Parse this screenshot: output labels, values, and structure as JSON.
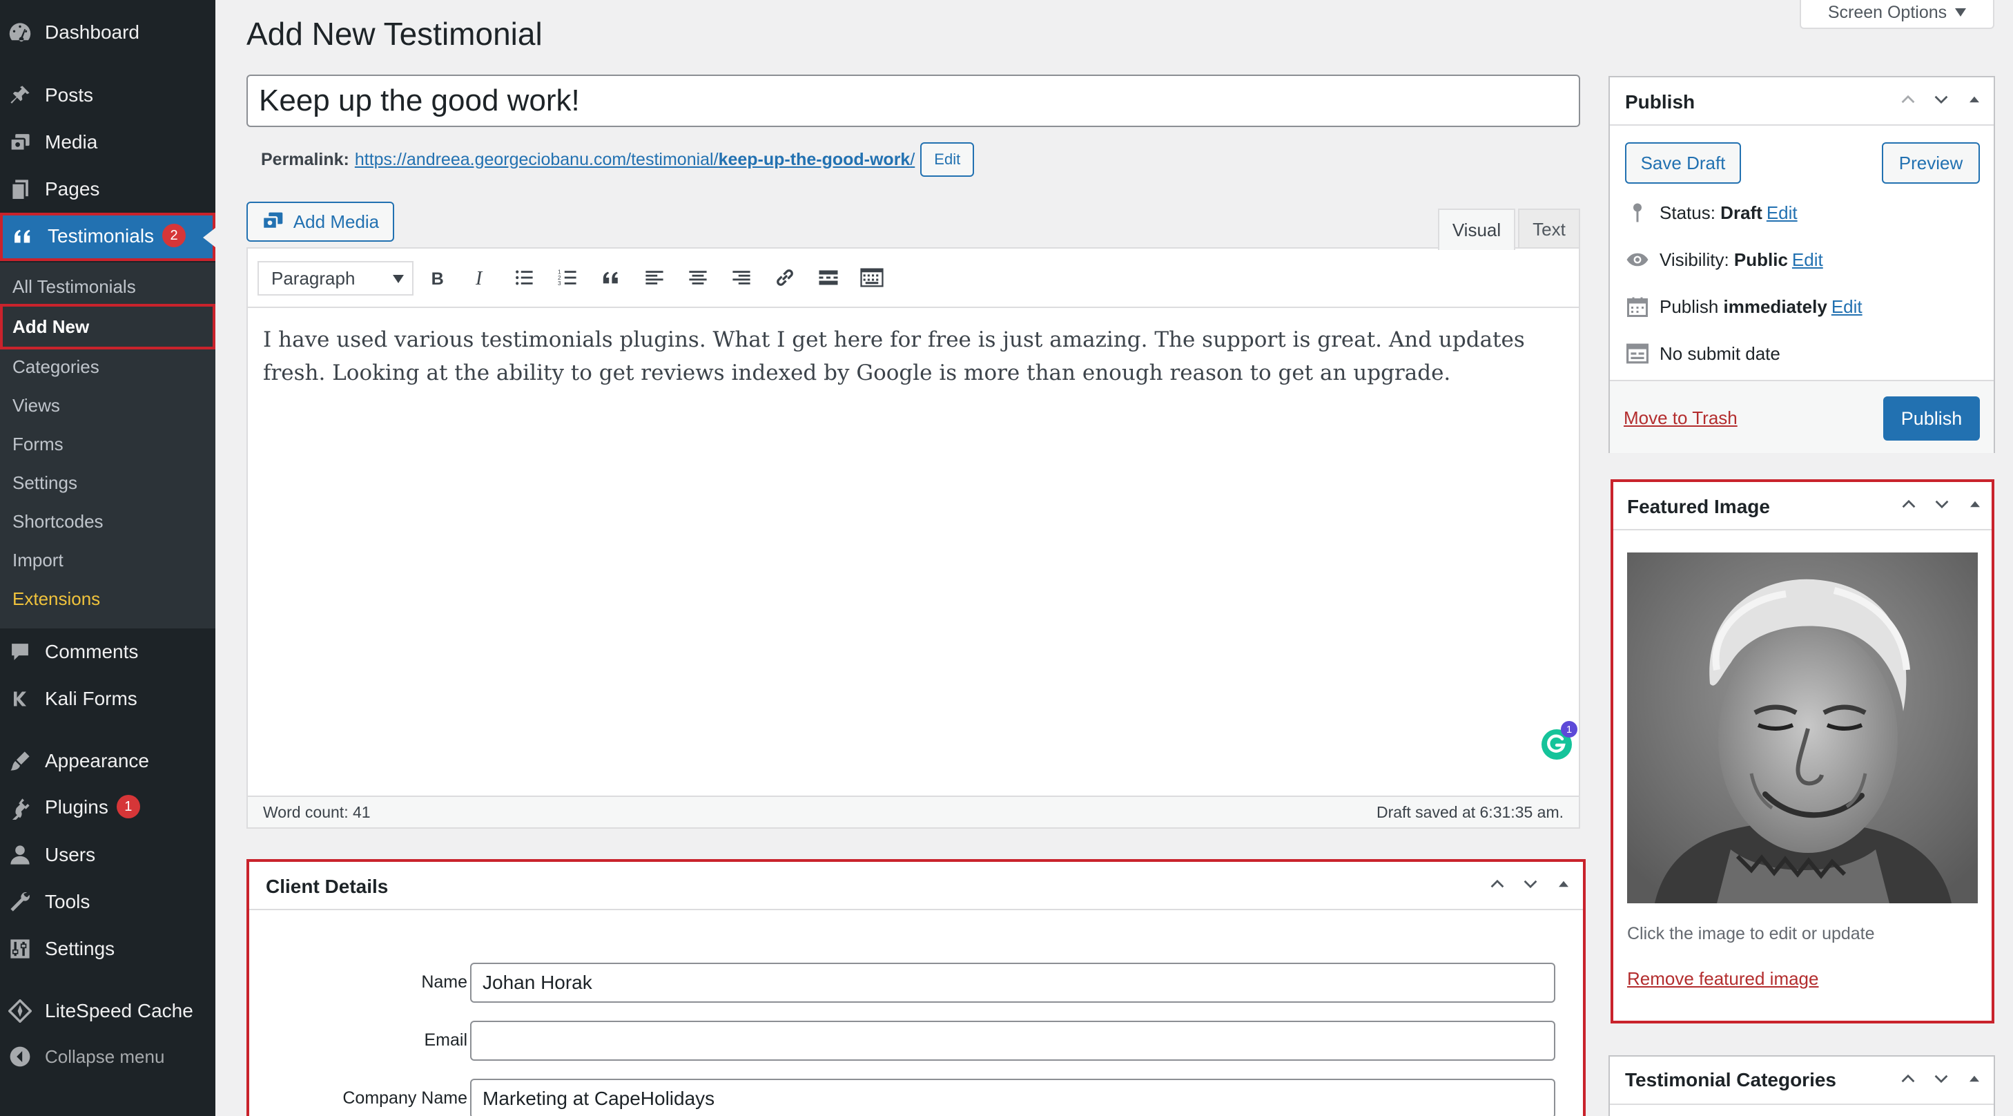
{
  "sidebar": {
    "items": [
      {
        "key": "dashboard",
        "label": "Dashboard",
        "icon": "dashboard-icon"
      },
      {
        "key": "posts",
        "label": "Posts",
        "icon": "pin-icon"
      },
      {
        "key": "media",
        "label": "Media",
        "icon": "media-icon"
      },
      {
        "key": "pages",
        "label": "Pages",
        "icon": "pages-icon"
      },
      {
        "key": "testimonials",
        "label": "Testimonials",
        "icon": "quote-icon",
        "badge": "2"
      },
      {
        "key": "comments",
        "label": "Comments",
        "icon": "comment-icon"
      },
      {
        "key": "kali-forms",
        "label": "Kali Forms",
        "icon": "kali-k-icon"
      },
      {
        "key": "appearance",
        "label": "Appearance",
        "icon": "brush-icon"
      },
      {
        "key": "plugins",
        "label": "Plugins",
        "icon": "plug-icon",
        "badge": "1"
      },
      {
        "key": "users",
        "label": "Users",
        "icon": "user-icon"
      },
      {
        "key": "tools",
        "label": "Tools",
        "icon": "wrench-icon"
      },
      {
        "key": "settings",
        "label": "Settings",
        "icon": "settings-sliders-icon"
      },
      {
        "key": "litespeed",
        "label": "LiteSpeed Cache",
        "icon": "diamond-icon"
      },
      {
        "key": "collapse",
        "label": "Collapse menu",
        "icon": "collapse-arrow-icon"
      }
    ],
    "submenu": [
      "All Testimonials",
      "Add New",
      "Categories",
      "Views",
      "Forms",
      "Settings",
      "Shortcodes",
      "Import",
      "Extensions"
    ]
  },
  "header": {
    "title": "Add New Testimonial",
    "screen_options": "Screen Options"
  },
  "post": {
    "title": "Keep up the good work!",
    "permalink_label": "Permalink:",
    "permalink_base": "https://andreea.georgeciobanu.com/testimonial/",
    "permalink_slug": "keep-up-the-good-work",
    "permalink_trailing": "/",
    "permalink_edit": "Edit"
  },
  "editor": {
    "add_media": "Add Media",
    "tab_visual": "Visual",
    "tab_text": "Text",
    "format_select": "Paragraph",
    "content": "I have used various testimonials plugins. What I get here for free is just amazing. The support is great. And updates fresh. Looking at the ability to get reviews indexed by Google is more than enough reason to get an upgrade.",
    "word_count": "Word count: 41",
    "draft_saved": "Draft saved at 6:31:35 am.",
    "grammarly_count": "1"
  },
  "client_details": {
    "title": "Client Details",
    "name_label": "Name",
    "name_value": "Johan Horak",
    "email_label": "Email",
    "email_value": "",
    "company_label": "Company Name",
    "company_value": "Marketing at CapeHolidays"
  },
  "publish": {
    "title": "Publish",
    "save_draft": "Save Draft",
    "preview": "Preview",
    "status_label": "Status:",
    "status_value": "Draft",
    "visibility_label": "Visibility:",
    "visibility_value": "Public",
    "publish_label": "Publish",
    "publish_value": "immediately",
    "no_submit": "No submit date",
    "edit": "Edit",
    "trash": "Move to Trash",
    "publish_button": "Publish"
  },
  "featured_image": {
    "title": "Featured Image",
    "hint": "Click the image to edit or update",
    "remove": "Remove featured image"
  },
  "categories_box": {
    "title": "Testimonial Categories"
  },
  "colors": {
    "sidebar_bg": "#1d2327",
    "submenu_bg": "#2c3338",
    "accent": "#2271b1",
    "highlight_outline": "#c9232c",
    "extensions_text": "#f0c33c"
  }
}
